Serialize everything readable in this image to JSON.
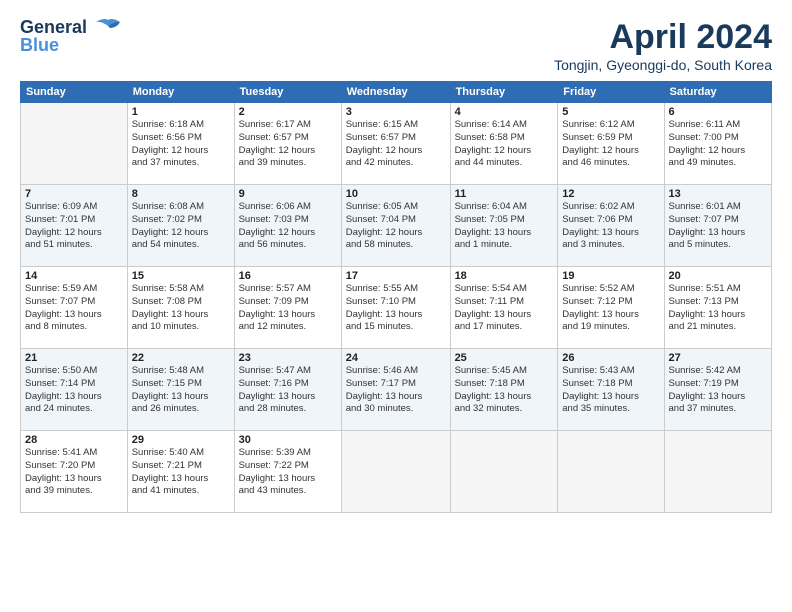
{
  "header": {
    "logo_line1": "General",
    "logo_line2": "Blue",
    "month": "April 2024",
    "location": "Tongjin, Gyeonggi-do, South Korea"
  },
  "weekdays": [
    "Sunday",
    "Monday",
    "Tuesday",
    "Wednesday",
    "Thursday",
    "Friday",
    "Saturday"
  ],
  "weeks": [
    [
      {
        "day": "",
        "info": ""
      },
      {
        "day": "1",
        "info": "Sunrise: 6:18 AM\nSunset: 6:56 PM\nDaylight: 12 hours\nand 37 minutes."
      },
      {
        "day": "2",
        "info": "Sunrise: 6:17 AM\nSunset: 6:57 PM\nDaylight: 12 hours\nand 39 minutes."
      },
      {
        "day": "3",
        "info": "Sunrise: 6:15 AM\nSunset: 6:57 PM\nDaylight: 12 hours\nand 42 minutes."
      },
      {
        "day": "4",
        "info": "Sunrise: 6:14 AM\nSunset: 6:58 PM\nDaylight: 12 hours\nand 44 minutes."
      },
      {
        "day": "5",
        "info": "Sunrise: 6:12 AM\nSunset: 6:59 PM\nDaylight: 12 hours\nand 46 minutes."
      },
      {
        "day": "6",
        "info": "Sunrise: 6:11 AM\nSunset: 7:00 PM\nDaylight: 12 hours\nand 49 minutes."
      }
    ],
    [
      {
        "day": "7",
        "info": "Sunrise: 6:09 AM\nSunset: 7:01 PM\nDaylight: 12 hours\nand 51 minutes."
      },
      {
        "day": "8",
        "info": "Sunrise: 6:08 AM\nSunset: 7:02 PM\nDaylight: 12 hours\nand 54 minutes."
      },
      {
        "day": "9",
        "info": "Sunrise: 6:06 AM\nSunset: 7:03 PM\nDaylight: 12 hours\nand 56 minutes."
      },
      {
        "day": "10",
        "info": "Sunrise: 6:05 AM\nSunset: 7:04 PM\nDaylight: 12 hours\nand 58 minutes."
      },
      {
        "day": "11",
        "info": "Sunrise: 6:04 AM\nSunset: 7:05 PM\nDaylight: 13 hours\nand 1 minute."
      },
      {
        "day": "12",
        "info": "Sunrise: 6:02 AM\nSunset: 7:06 PM\nDaylight: 13 hours\nand 3 minutes."
      },
      {
        "day": "13",
        "info": "Sunrise: 6:01 AM\nSunset: 7:07 PM\nDaylight: 13 hours\nand 5 minutes."
      }
    ],
    [
      {
        "day": "14",
        "info": "Sunrise: 5:59 AM\nSunset: 7:07 PM\nDaylight: 13 hours\nand 8 minutes."
      },
      {
        "day": "15",
        "info": "Sunrise: 5:58 AM\nSunset: 7:08 PM\nDaylight: 13 hours\nand 10 minutes."
      },
      {
        "day": "16",
        "info": "Sunrise: 5:57 AM\nSunset: 7:09 PM\nDaylight: 13 hours\nand 12 minutes."
      },
      {
        "day": "17",
        "info": "Sunrise: 5:55 AM\nSunset: 7:10 PM\nDaylight: 13 hours\nand 15 minutes."
      },
      {
        "day": "18",
        "info": "Sunrise: 5:54 AM\nSunset: 7:11 PM\nDaylight: 13 hours\nand 17 minutes."
      },
      {
        "day": "19",
        "info": "Sunrise: 5:52 AM\nSunset: 7:12 PM\nDaylight: 13 hours\nand 19 minutes."
      },
      {
        "day": "20",
        "info": "Sunrise: 5:51 AM\nSunset: 7:13 PM\nDaylight: 13 hours\nand 21 minutes."
      }
    ],
    [
      {
        "day": "21",
        "info": "Sunrise: 5:50 AM\nSunset: 7:14 PM\nDaylight: 13 hours\nand 24 minutes."
      },
      {
        "day": "22",
        "info": "Sunrise: 5:48 AM\nSunset: 7:15 PM\nDaylight: 13 hours\nand 26 minutes."
      },
      {
        "day": "23",
        "info": "Sunrise: 5:47 AM\nSunset: 7:16 PM\nDaylight: 13 hours\nand 28 minutes."
      },
      {
        "day": "24",
        "info": "Sunrise: 5:46 AM\nSunset: 7:17 PM\nDaylight: 13 hours\nand 30 minutes."
      },
      {
        "day": "25",
        "info": "Sunrise: 5:45 AM\nSunset: 7:18 PM\nDaylight: 13 hours\nand 32 minutes."
      },
      {
        "day": "26",
        "info": "Sunrise: 5:43 AM\nSunset: 7:18 PM\nDaylight: 13 hours\nand 35 minutes."
      },
      {
        "day": "27",
        "info": "Sunrise: 5:42 AM\nSunset: 7:19 PM\nDaylight: 13 hours\nand 37 minutes."
      }
    ],
    [
      {
        "day": "28",
        "info": "Sunrise: 5:41 AM\nSunset: 7:20 PM\nDaylight: 13 hours\nand 39 minutes."
      },
      {
        "day": "29",
        "info": "Sunrise: 5:40 AM\nSunset: 7:21 PM\nDaylight: 13 hours\nand 41 minutes."
      },
      {
        "day": "30",
        "info": "Sunrise: 5:39 AM\nSunset: 7:22 PM\nDaylight: 13 hours\nand 43 minutes."
      },
      {
        "day": "",
        "info": ""
      },
      {
        "day": "",
        "info": ""
      },
      {
        "day": "",
        "info": ""
      },
      {
        "day": "",
        "info": ""
      }
    ]
  ]
}
